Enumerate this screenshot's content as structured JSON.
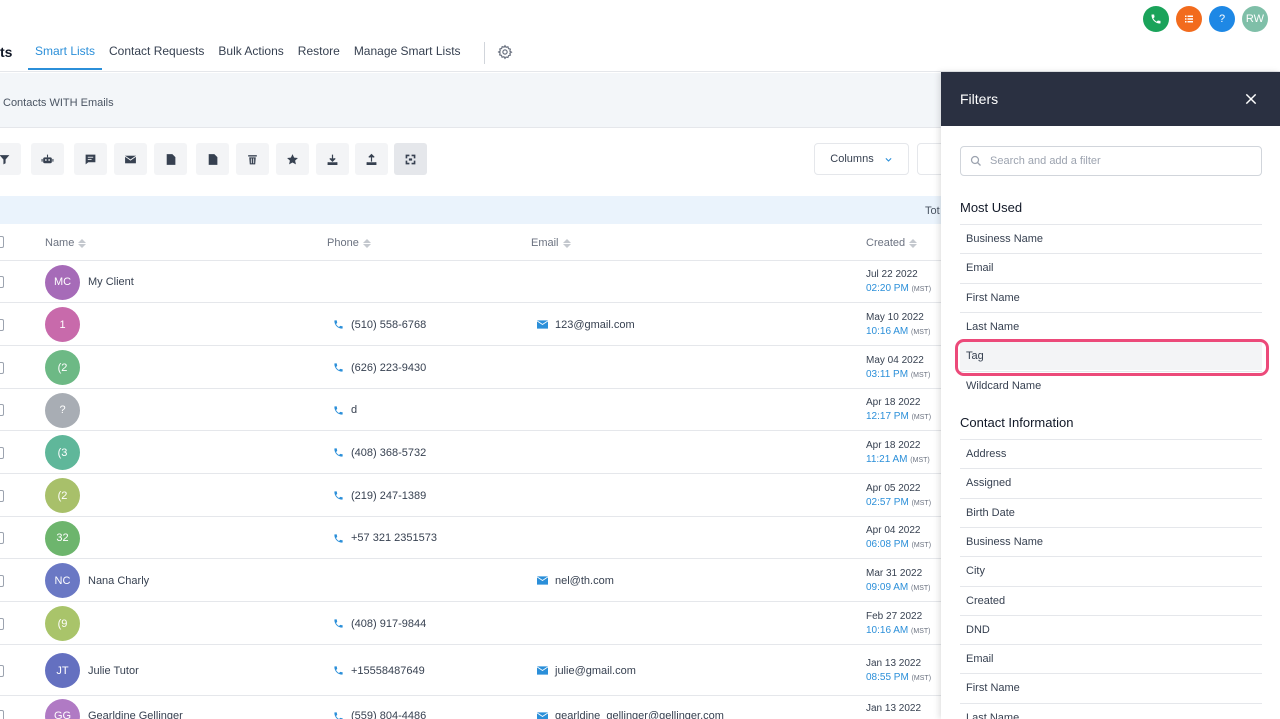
{
  "header": {
    "title_fragment": "ts",
    "tabs": [
      {
        "label": "Smart Lists",
        "active": true
      },
      {
        "label": "Contact Requests",
        "active": false
      },
      {
        "label": "Bulk Actions",
        "active": false
      },
      {
        "label": "Restore",
        "active": false
      },
      {
        "label": "Manage Smart Lists",
        "active": false
      }
    ],
    "top_icons": [
      {
        "name": "phone-icon",
        "label": "",
        "color": "#1aa35a"
      },
      {
        "name": "list-icon",
        "label": "",
        "color": "#f26b1d"
      },
      {
        "name": "help-icon",
        "label": "?",
        "color": "#1e88e5"
      },
      {
        "name": "user-avatar",
        "label": "RW",
        "color": "#7fbfa8"
      }
    ]
  },
  "subheader": {
    "list_name": "Contacts WITH Emails"
  },
  "toolbar": {
    "buttons": [
      "filter-icon",
      "robot-icon",
      "message-icon",
      "email-icon",
      "add-tag-icon",
      "remove-tag-icon",
      "delete-icon",
      "star-icon",
      "import-icon",
      "export-icon",
      "merge-icon"
    ],
    "columns_label": "Columns"
  },
  "total_label": "Tot",
  "table": {
    "columns": [
      "Name",
      "Phone",
      "Email",
      "Created"
    ],
    "rows": [
      {
        "initials": "MC",
        "color": "#a66bb8",
        "name": "My Client",
        "phone": "",
        "email": "",
        "date": "Jul 22 2022",
        "time": "02:20 PM",
        "tz": "(MST)"
      },
      {
        "initials": "1",
        "color": "#c86aab",
        "name": "",
        "phone": "(510) 558-6768",
        "email": "123@gmail.com",
        "date": "May 10 2022",
        "time": "10:16 AM",
        "tz": "(MST)"
      },
      {
        "initials": "(2",
        "color": "#6db985",
        "name": "",
        "phone": "(626) 223-9430",
        "email": "",
        "date": "May 04 2022",
        "time": "03:11 PM",
        "tz": "(MST)"
      },
      {
        "initials": "?",
        "color": "#a8adb4",
        "name": "",
        "phone": "d",
        "email": "",
        "date": "Apr 18 2022",
        "time": "12:17 PM",
        "tz": "(MST)"
      },
      {
        "initials": "(3",
        "color": "#5fb79a",
        "name": "",
        "phone": "(408) 368-5732",
        "email": "",
        "date": "Apr 18 2022",
        "time": "11:21 AM",
        "tz": "(MST)"
      },
      {
        "initials": "(2",
        "color": "#a8c06a",
        "name": "",
        "phone": "(219) 247-1389",
        "email": "",
        "date": "Apr 05 2022",
        "time": "02:57 PM",
        "tz": "(MST)"
      },
      {
        "initials": "32",
        "color": "#6db56d",
        "name": "",
        "phone": "+57 321 2351573",
        "email": "",
        "date": "Apr 04 2022",
        "time": "06:08 PM",
        "tz": "(MST)"
      },
      {
        "initials": "NC",
        "color": "#6a78c4",
        "name": "Nana Charly",
        "phone": "",
        "email": "nel@th.com",
        "date": "Mar 31 2022",
        "time": "09:09 AM",
        "tz": "(MST)"
      },
      {
        "initials": "(9",
        "color": "#a9c46a",
        "name": "",
        "phone": "(408) 917-9844",
        "email": "",
        "date": "Feb 27 2022",
        "time": "10:16 AM",
        "tz": "(MST)"
      },
      {
        "initials": "JT",
        "color": "#6470c0",
        "name": "Julie Tutor",
        "phone": "+15558487649",
        "email": "julie@gmail.com",
        "date": "Jan 13 2022",
        "time": "08:55 PM",
        "tz": "(MST)"
      },
      {
        "initials": "GG",
        "color": "#b07ac4",
        "name": "Gearldine Gellinger",
        "phone": "(559) 804-4486",
        "email": "gearldine_gellinger@gellinger.com",
        "date": "Jan 13 2022",
        "time": "",
        "tz": ""
      }
    ]
  },
  "filters": {
    "title": "Filters",
    "search_placeholder": "Search and add a filter",
    "most_used_title": "Most Used",
    "most_used": [
      "Business Name",
      "Email",
      "First Name",
      "Last Name",
      "Tag",
      "Wildcard Name"
    ],
    "contact_info_title": "Contact Information",
    "contact_info": [
      "Address",
      "Assigned",
      "Birth Date",
      "Business Name",
      "City",
      "Created",
      "DND",
      "Email",
      "First Name",
      "Last Name"
    ],
    "highlighted_item": "Tag",
    "highlight_color": "#ec4a7a"
  }
}
